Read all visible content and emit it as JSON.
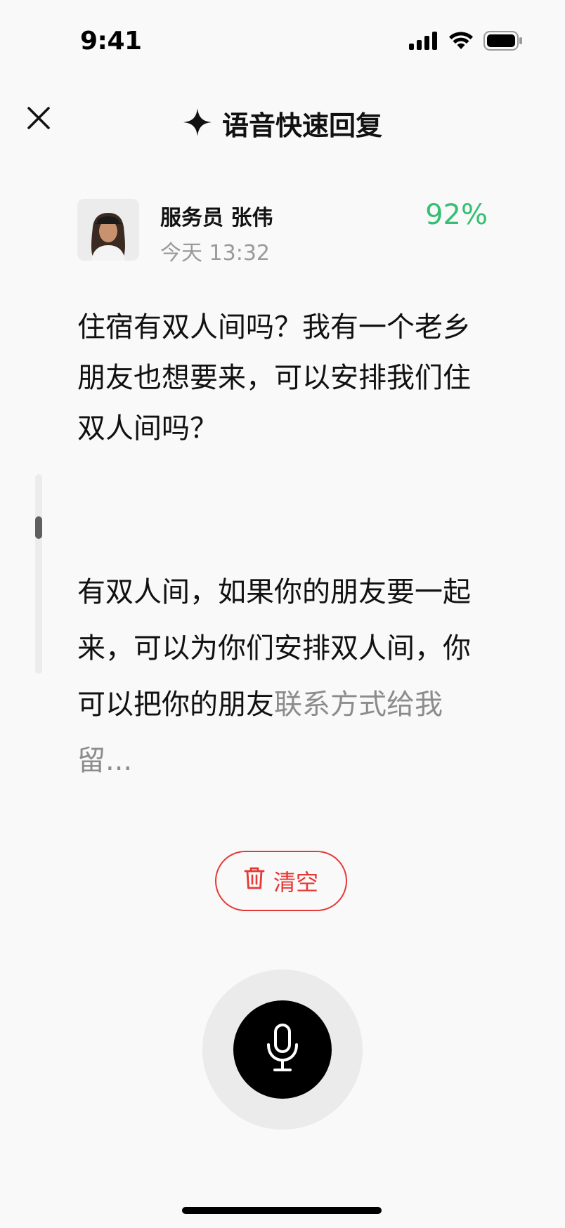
{
  "status_bar": {
    "time": "9:41"
  },
  "header": {
    "title": "语音快速回复",
    "close_icon": "close-icon",
    "sparkle_icon": "sparkle-icon"
  },
  "sender": {
    "name": "服务员 张伟",
    "time": "今天 13:32",
    "confidence": "92%"
  },
  "question": {
    "text": "住宿有双人间吗？我有一个老乡朋友也想要来，可以安排我们住双人间吗？"
  },
  "answer": {
    "confirmed_text": "有双人间，如果你的朋友要一起来，可以为你们安排双人间，你可以把你的朋友",
    "pending_text": "联系方式给我留..."
  },
  "actions": {
    "clear_label": "清空"
  },
  "colors": {
    "accent_green": "#34bf72",
    "danger_red": "#e53935",
    "mic_background": "#000000"
  }
}
